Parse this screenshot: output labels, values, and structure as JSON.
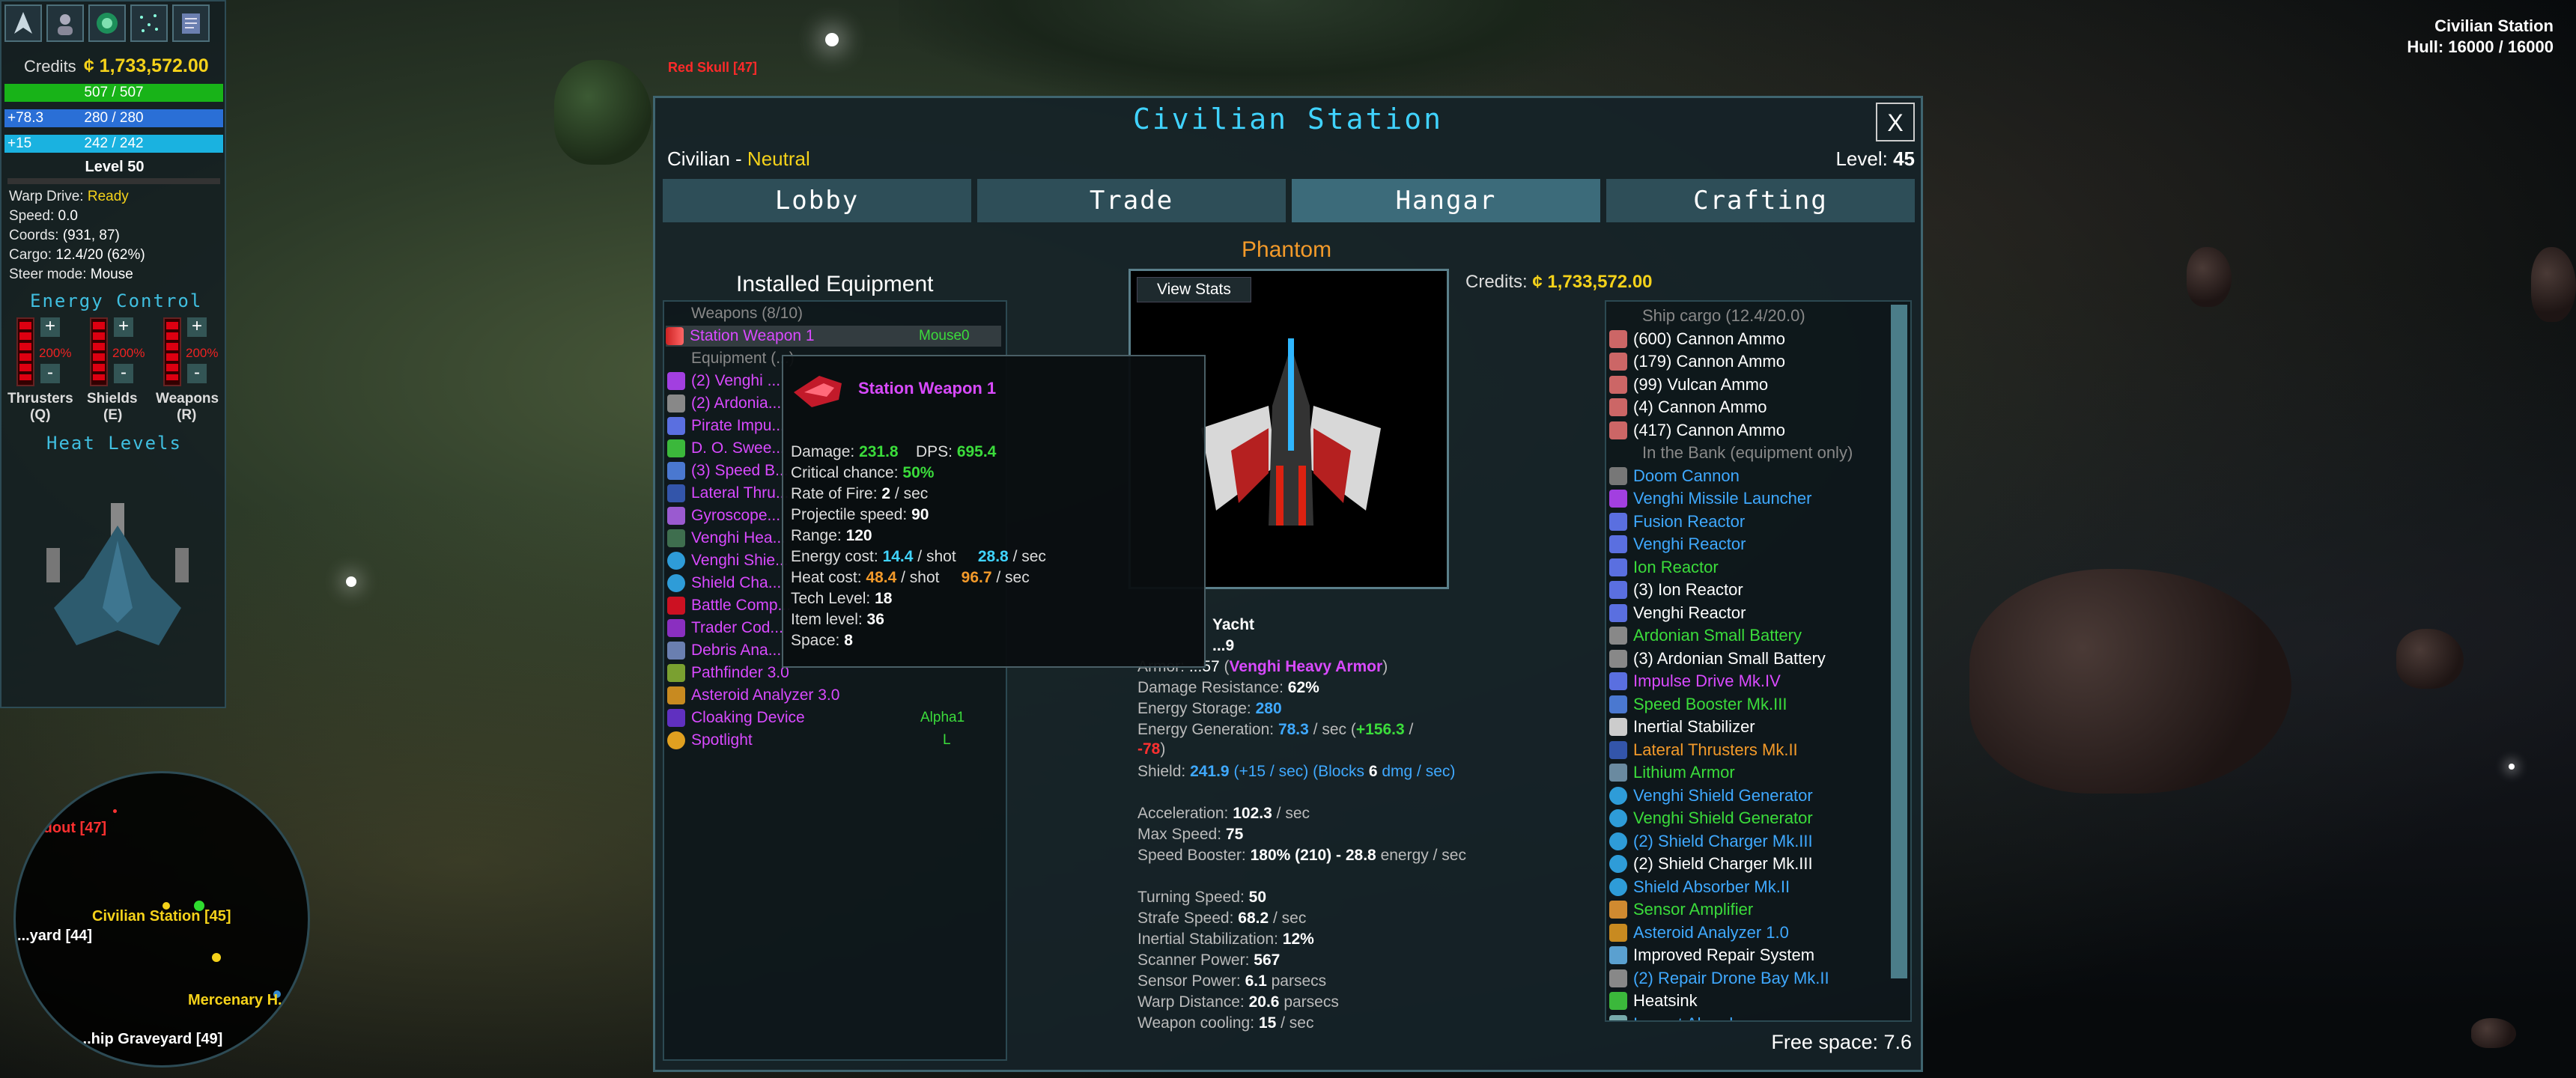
{
  "hud": {
    "credits_label": "Credits",
    "credits_value": "¢ 1,733,572.00",
    "hull_bar": "507 / 507",
    "shield_bar_left": "+78.3",
    "shield_bar": "280 / 280",
    "energy_bar_left": "+15",
    "energy_bar": "242 / 242",
    "level": "Level 50",
    "warp_label": "Warp Drive:",
    "warp_value": "Ready",
    "speed_label": "Speed:",
    "speed_value": "0.0",
    "coords_label": "Coords:",
    "coords_value": "(931, 87)",
    "cargo_label": "Cargo:",
    "cargo_value": "12.4/20 (62%)",
    "steer_label": "Steer mode:",
    "steer_value": "Mouse",
    "energy_control_title": "Energy Control",
    "controls": [
      {
        "name": "Thrusters",
        "key": "(Q)",
        "pct": "200%"
      },
      {
        "name": "Shields",
        "key": "(E)",
        "pct": "200%"
      },
      {
        "name": "Weapons",
        "key": "(R)",
        "pct": "200%"
      }
    ],
    "plus": "+",
    "minus": "-",
    "heat_title": "Heat Levels"
  },
  "target": {
    "name": "Civilian Station",
    "hull": "Hull: 16000 / 16000"
  },
  "world_labels": {
    "red_skull": "Red Skull [47]"
  },
  "minimap": {
    "labels": [
      {
        "text": "...dout [47]",
        "color": "#ff3030"
      },
      {
        "text": "Civilian Station [45]",
        "color": "#f5d21a"
      },
      {
        "text": "...yard [44]",
        "color": "#ffffff"
      },
      {
        "text": "Mercenary H...",
        "color": "#f5d21a"
      },
      {
        "text": "...hip Graveyard [49]",
        "color": "#ffffff"
      }
    ]
  },
  "dialog": {
    "title": "Civilian Station",
    "close": "X",
    "faction": "Civilian",
    "faction_sep": " - ",
    "stance": "Neutral",
    "level_label": "Level:",
    "level_value": "45",
    "tabs": [
      "Lobby",
      "Trade",
      "Hangar",
      "Crafting"
    ],
    "ship_name": "Phantom",
    "view_stats": "View Stats",
    "credits_label": "Credits:",
    "credits_value": "¢ 1,733,572.00",
    "installed_title": "Installed Equipment",
    "free_space": "Free space: 7.6"
  },
  "installed": [
    {
      "text": "Weapons (8/10)",
      "color": "#888888",
      "icon": ""
    },
    {
      "text": "Station Weapon 1",
      "color": "#d94aff",
      "icon": "weapon-icon",
      "key": "Mouse0",
      "selected": true
    },
    {
      "text": "Equipment (...)",
      "color": "#888888",
      "icon": ""
    },
    {
      "text": "(2) Venghi ...",
      "color": "#d94aff",
      "icon": "venghi-icon"
    },
    {
      "text": "(2) Ardonia...",
      "color": "#d94aff",
      "icon": "battery-icon"
    },
    {
      "text": "Pirate Impu...",
      "color": "#d94aff",
      "icon": "impulse-icon"
    },
    {
      "text": "D. O. Swee...",
      "color": "#d94aff",
      "icon": "sweeper-icon"
    },
    {
      "text": "(3) Speed B...",
      "color": "#d94aff",
      "icon": "booster-icon"
    },
    {
      "text": "Lateral Thru...",
      "color": "#d94aff",
      "icon": "thruster-icon"
    },
    {
      "text": "Gyroscope...",
      "color": "#d94aff",
      "icon": "gyroscope-icon"
    },
    {
      "text": "Venghi Hea...",
      "color": "#d94aff",
      "icon": "armor-icon"
    },
    {
      "text": "Venghi Shie...",
      "color": "#d94aff",
      "icon": "shield-icon"
    },
    {
      "text": "Shield Cha...",
      "color": "#d94aff",
      "icon": "shield-icon"
    },
    {
      "text": "Battle Comp...",
      "color": "#d94aff",
      "icon": "computer-icon"
    },
    {
      "text": "Trader Cod...",
      "color": "#d94aff",
      "icon": "codex-icon"
    },
    {
      "text": "Debris Ana...",
      "color": "#d94aff",
      "icon": "analyzer-icon"
    },
    {
      "text": "Pathfinder 3.0",
      "color": "#d94aff",
      "icon": "pathfinder-icon"
    },
    {
      "text": "Asteroid Analyzer 3.0",
      "color": "#d94aff",
      "icon": "analyzer-icon"
    },
    {
      "text": "Cloaking Device",
      "color": "#d94aff",
      "icon": "cloak-icon",
      "key": "Alpha1"
    },
    {
      "text": "Spotlight",
      "color": "#d94aff",
      "icon": "spotlight-icon",
      "key": "L"
    }
  ],
  "tooltip": {
    "name": "Station Weapon 1",
    "damage_label": "Damage:",
    "damage_value": "231.8",
    "dps_label": "DPS:",
    "dps_value": "695.4",
    "crit_label": "Critical chance:",
    "crit_value": "50%",
    "rof_label": "Rate of Fire:",
    "rof_value": "2",
    "rof_unit": "/ sec",
    "proj_label": "Projectile speed:",
    "proj_value": "90",
    "range_label": "Range:",
    "range_value": "120",
    "ecost_label": "Energy cost:",
    "ecost_shot": "14.4",
    "ecost_shot_unit": "/ shot",
    "ecost_sec": "28.8",
    "ecost_sec_unit": "/ sec",
    "hcost_label": "Heat cost:",
    "hcost_shot": "48.4",
    "hcost_shot_unit": "/ shot",
    "hcost_sec": "96.7",
    "hcost_sec_unit": "/ sec",
    "tech_label": "Tech Level:",
    "tech_value": "18",
    "ilvl_label": "Item level:",
    "ilvl_value": "36",
    "space_label": "Space:",
    "space_value": "8"
  },
  "ship_stats": {
    "class_tail": "Yacht",
    "level_tail": "...9",
    "armor_label": "Armor:",
    "armor_value": "...57",
    "armor_item": "Venghi Heavy Armor",
    "dr_label": "Damage Resistance:",
    "dr_value": "62%",
    "es_label": "Energy Storage:",
    "es_value": "280",
    "eg_label": "Energy Generation:",
    "eg_value": "78.3",
    "eg_unit": "/ sec (",
    "eg_plus": "+156.3",
    "eg_slash": " /",
    "eg_minus": "-78",
    "eg_close": ")",
    "sh_label": "Shield:",
    "sh_value": "241.9",
    "sh_regen": "(+15 / sec)",
    "sh_block_pre": "(Blocks",
    "sh_block": "6",
    "sh_block_post": "dmg / sec)",
    "acc_label": "Acceleration:",
    "acc_value": "102.3",
    "acc_unit": "/ sec",
    "maxsp_label": "Max Speed:",
    "maxsp_value": "75",
    "sb_label": "Speed Booster:",
    "sb_value": "180% (210) - 28.8",
    "sb_unit": "energy / sec",
    "turn_label": "Turning Speed:",
    "turn_value": "50",
    "strafe_label": "Strafe Speed:",
    "strafe_value": "68.2",
    "strafe_unit": "/ sec",
    "inert_label": "Inertial Stabilization:",
    "inert_value": "12%",
    "scan_label": "Scanner Power:",
    "scan_value": "567",
    "sensor_label": "Sensor Power:",
    "sensor_value": "6.1",
    "sensor_unit": "parsecs",
    "warp_label": "Warp Distance:",
    "warp_value": "20.6",
    "warp_unit": "parsecs",
    "cool_label": "Weapon cooling:",
    "cool_value": "15",
    "cool_unit": "/ sec"
  },
  "cargo": [
    {
      "text": "Ship cargo (12.4/20.0)",
      "color": "#888888",
      "icon": ""
    },
    {
      "text": "(600) Cannon Ammo",
      "color": "#ffffff",
      "icon": "ammo-icon"
    },
    {
      "text": "(179) Cannon Ammo",
      "color": "#ffffff",
      "icon": "ammo-icon"
    },
    {
      "text": "(99) Vulcan Ammo",
      "color": "#ffffff",
      "icon": "ammo-icon"
    },
    {
      "text": "(4) Cannon Ammo",
      "color": "#ffffff",
      "icon": "ammo-icon"
    },
    {
      "text": "(417) Cannon Ammo",
      "color": "#ffffff",
      "icon": "ammo-icon"
    },
    {
      "text": "In the Bank (equipment only)",
      "color": "#888888",
      "icon": ""
    },
    {
      "text": "Doom Cannon",
      "color": "#3fa9ff",
      "icon": "cannon-icon"
    },
    {
      "text": "Venghi Missile Launcher",
      "color": "#3fa9ff",
      "icon": "launcher-icon"
    },
    {
      "text": "Fusion Reactor",
      "color": "#3fa9ff",
      "icon": "reactor-icon"
    },
    {
      "text": "Venghi Reactor",
      "color": "#3fa9ff",
      "icon": "reactor-icon"
    },
    {
      "text": "Ion Reactor",
      "color": "#3bdc3b",
      "icon": "reactor-icon"
    },
    {
      "text": "(3) Ion Reactor",
      "color": "#ffffff",
      "icon": "reactor-icon"
    },
    {
      "text": "Venghi Reactor",
      "color": "#ffffff",
      "icon": "reactor-icon"
    },
    {
      "text": "Ardonian Small Battery",
      "color": "#3bdc3b",
      "icon": "battery-icon"
    },
    {
      "text": "(3) Ardonian Small Battery",
      "color": "#ffffff",
      "icon": "battery-icon"
    },
    {
      "text": "Impulse Drive Mk.IV",
      "color": "#d94aff",
      "icon": "impulse-icon"
    },
    {
      "text": "Speed Booster Mk.III",
      "color": "#3bdc3b",
      "icon": "booster-icon"
    },
    {
      "text": "Inertial Stabilizer",
      "color": "#ffffff",
      "icon": "gear-icon"
    },
    {
      "text": "Lateral Thrusters Mk.II",
      "color": "#f39a2a",
      "icon": "thruster-icon"
    },
    {
      "text": "Lithium Armor",
      "color": "#3bdc3b",
      "icon": "armor-icon"
    },
    {
      "text": "Venghi Shield Generator",
      "color": "#3fa9ff",
      "icon": "shield-icon"
    },
    {
      "text": "Venghi Shield Generator",
      "color": "#3bdc3b",
      "icon": "shield-icon"
    },
    {
      "text": "(2) Shield Charger Mk.III",
      "color": "#3fa9ff",
      "icon": "shield-icon"
    },
    {
      "text": "(2) Shield Charger Mk.III",
      "color": "#ffffff",
      "icon": "shield-icon"
    },
    {
      "text": "Shield Absorber Mk.II",
      "color": "#3fa9ff",
      "icon": "shield-icon"
    },
    {
      "text": "Sensor Amplifier",
      "color": "#3bdc3b",
      "icon": "sensor-icon"
    },
    {
      "text": "Asteroid Analyzer 1.0",
      "color": "#3fa9ff",
      "icon": "analyzer-icon"
    },
    {
      "text": "Improved Repair System",
      "color": "#ffffff",
      "icon": "repair-icon"
    },
    {
      "text": "(2) Repair Drone Bay Mk.II",
      "color": "#3fa9ff",
      "icon": "drone-icon"
    },
    {
      "text": "Heatsink",
      "color": "#ffffff",
      "icon": "heatsink-icon"
    },
    {
      "text": "Impact Absorber",
      "color": "#3fa9ff",
      "icon": "absorber-icon"
    }
  ]
}
